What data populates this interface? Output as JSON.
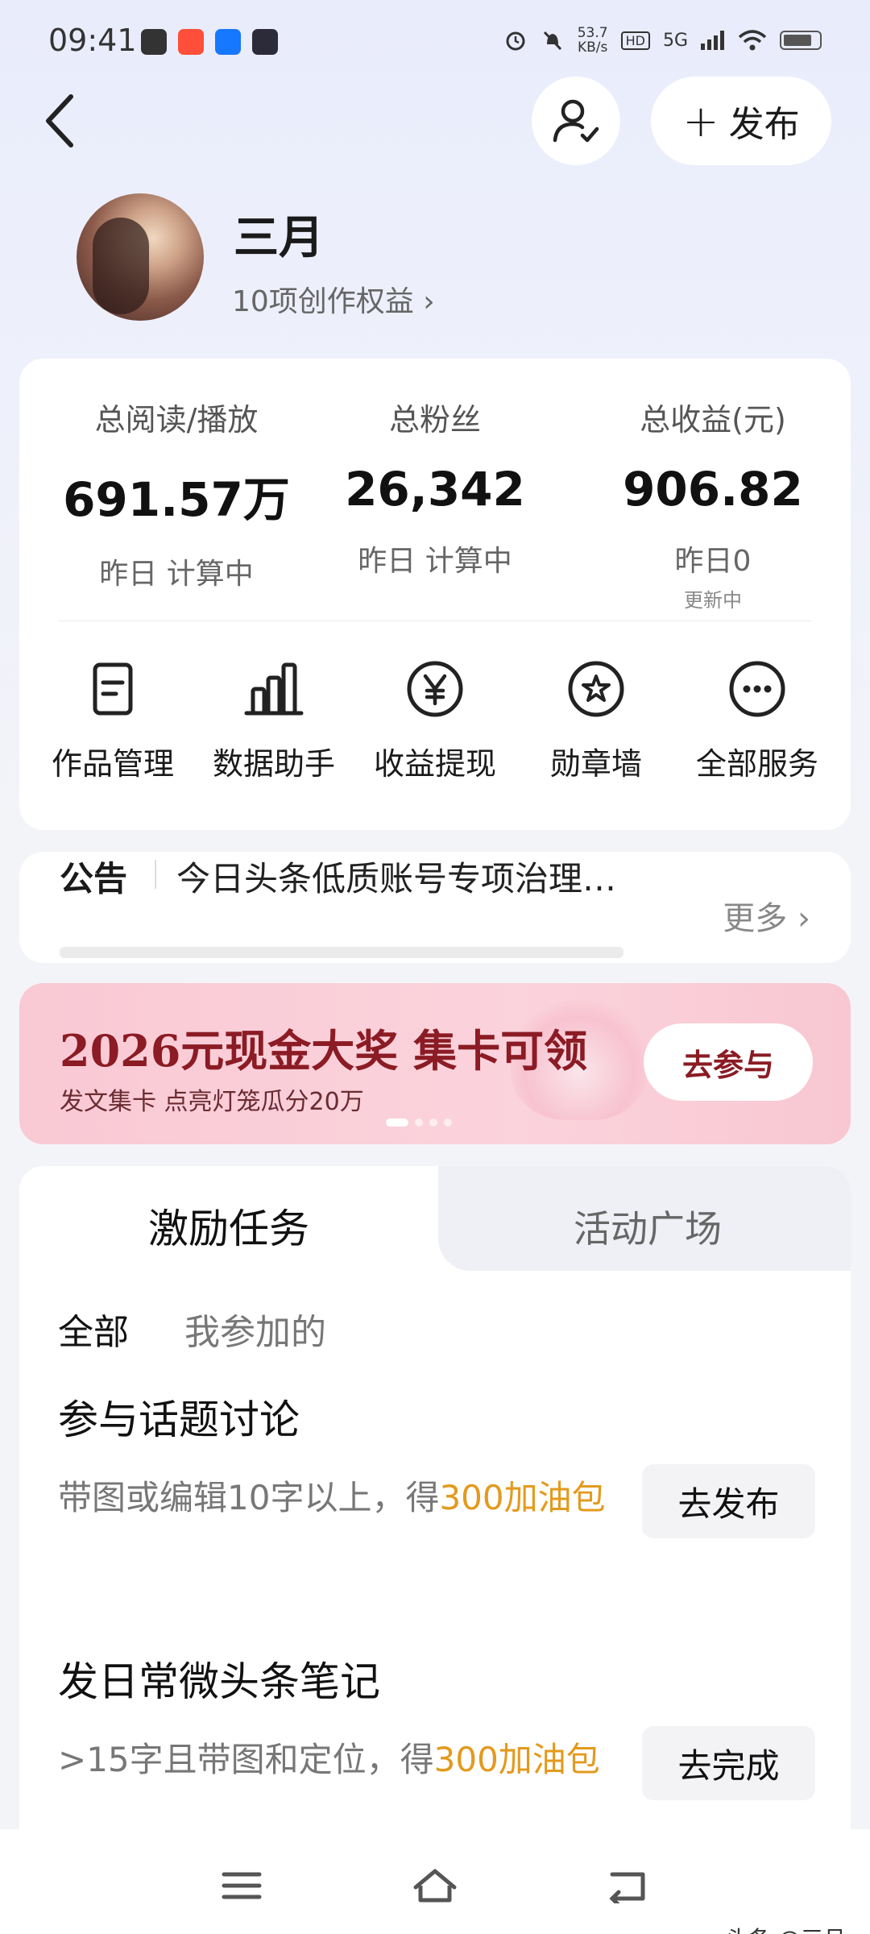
{
  "status_bar": {
    "time": "09:41",
    "speed_value": "53.7",
    "speed_unit": "KB/s",
    "hd": "HD",
    "network": "5G"
  },
  "header": {
    "publish_label": "发布"
  },
  "profile": {
    "name": "三月",
    "rights_link": "10项创作权益 ›"
  },
  "stats": [
    {
      "label": "总阅读/播放",
      "value": "691.57万",
      "sub": "昨日 计算中",
      "sub2": ""
    },
    {
      "label": "总粉丝",
      "value": "26,342",
      "sub": "昨日 计算中",
      "sub2": ""
    },
    {
      "label": "总收益(元)",
      "value": "906.82",
      "sub": "昨日0",
      "sub2": "更新中"
    }
  ],
  "services": [
    {
      "label": "作品管理",
      "icon": "document-icon"
    },
    {
      "label": "数据助手",
      "icon": "bar-chart-icon"
    },
    {
      "label": "收益提现",
      "icon": "yen-icon"
    },
    {
      "label": "勋章墙",
      "icon": "medal-icon"
    },
    {
      "label": "全部服务",
      "icon": "more-icon"
    }
  ],
  "notice": {
    "tag": "公告",
    "text": "今日头条低质账号专项治理…",
    "more": "更多 ›"
  },
  "banner": {
    "title": "2026元现金大奖 集卡可领",
    "subtitle": "发文集卡 点亮灯笼瓜分20万",
    "button": "去参与"
  },
  "tasks_panel": {
    "tab_active": "激励任务",
    "tab_inactive": "活动广场",
    "filter_all": "全部",
    "filter_mine": "我参加的",
    "tasks": [
      {
        "title": "参与话题讨论",
        "desc_prefix": "带图或编辑10字以上，得",
        "desc_highlight": "300加油包",
        "button": "去发布"
      },
      {
        "title": "发日常微头条笔记",
        "desc_prefix": ">15字且带图和定位，得",
        "desc_highlight": "300加油包",
        "button": "去完成"
      }
    ]
  },
  "watermark": "头条 @三月",
  "colors": {
    "accent_orange": "#e39a1e",
    "banner_red": "#8b1b24",
    "banner_pink": "#f9c9d4"
  }
}
